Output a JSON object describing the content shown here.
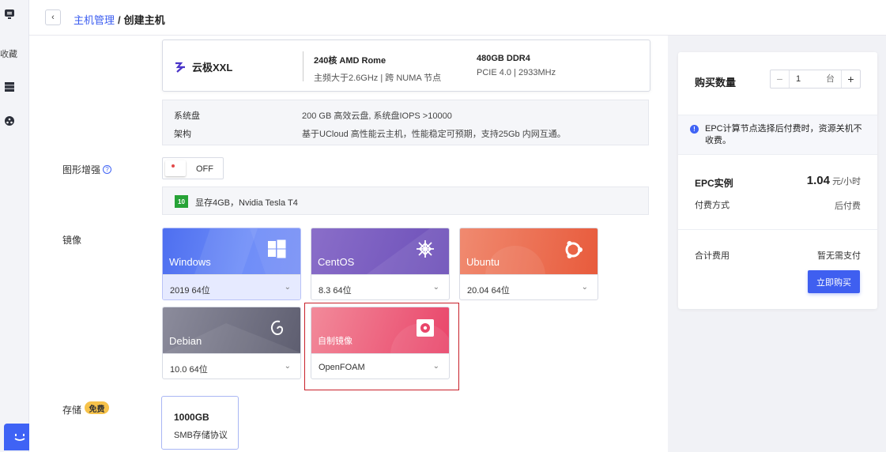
{
  "rail": {
    "favorites_label": "收藏"
  },
  "breadcrumb": {
    "parent": "主机管理",
    "separator": "/",
    "current": "创建主机"
  },
  "machine": {
    "brand": "云极XXL",
    "cpu_title": "240核 AMD Rome",
    "cpu_sub": "主频大于2.6GHz | 跨 NUMA 节点",
    "mem_title": "480GB DDR4",
    "mem_sub": "PCIE 4.0 | 2933MHz"
  },
  "disk": {
    "system_label": "系统盘",
    "system_value": "200 GB 高效云盘, 系统盘IOPS >10000",
    "arch_label": "架构",
    "arch_value": "基于UCloud 高性能云主机，性能稳定可预期，支持25Gb 内网互通。"
  },
  "graphics": {
    "label": "图形增强",
    "toggle_text": "OFF",
    "gpu_badge": "10",
    "gpu_text": "显存4GB，Nvidia Tesla T4"
  },
  "image": {
    "label": "镜像",
    "cards": [
      {
        "name": "Windows",
        "version": "2019 64位",
        "selected": true
      },
      {
        "name": "CentOS",
        "version": "8.3 64位"
      },
      {
        "name": "Ubuntu",
        "version": "20.04 64位"
      },
      {
        "name": "Debian",
        "version": "10.0 64位"
      },
      {
        "name": "自制镜像",
        "version": "OpenFOAM"
      }
    ]
  },
  "storage": {
    "label": "存储",
    "badge": "免费",
    "size": "1000GB",
    "protocol": "SMB存储协议"
  },
  "order": {
    "qty_label": "购买数量",
    "qty_value": "1",
    "qty_unit": "台",
    "notice": "EPC计算节点选择后付费时，资源关机不收费。",
    "epc_label": "EPC实例",
    "price_value": "1.04",
    "price_unit": "元/小时",
    "pay_label": "付费方式",
    "pay_value": "后付费",
    "total_label": "合计费用",
    "total_value": "暂无需支付",
    "buy_label": "立即购买"
  },
  "colors": {
    "accent": "#3f5ff0",
    "highlight": "#c8202a",
    "badge": "#f6c24a"
  }
}
